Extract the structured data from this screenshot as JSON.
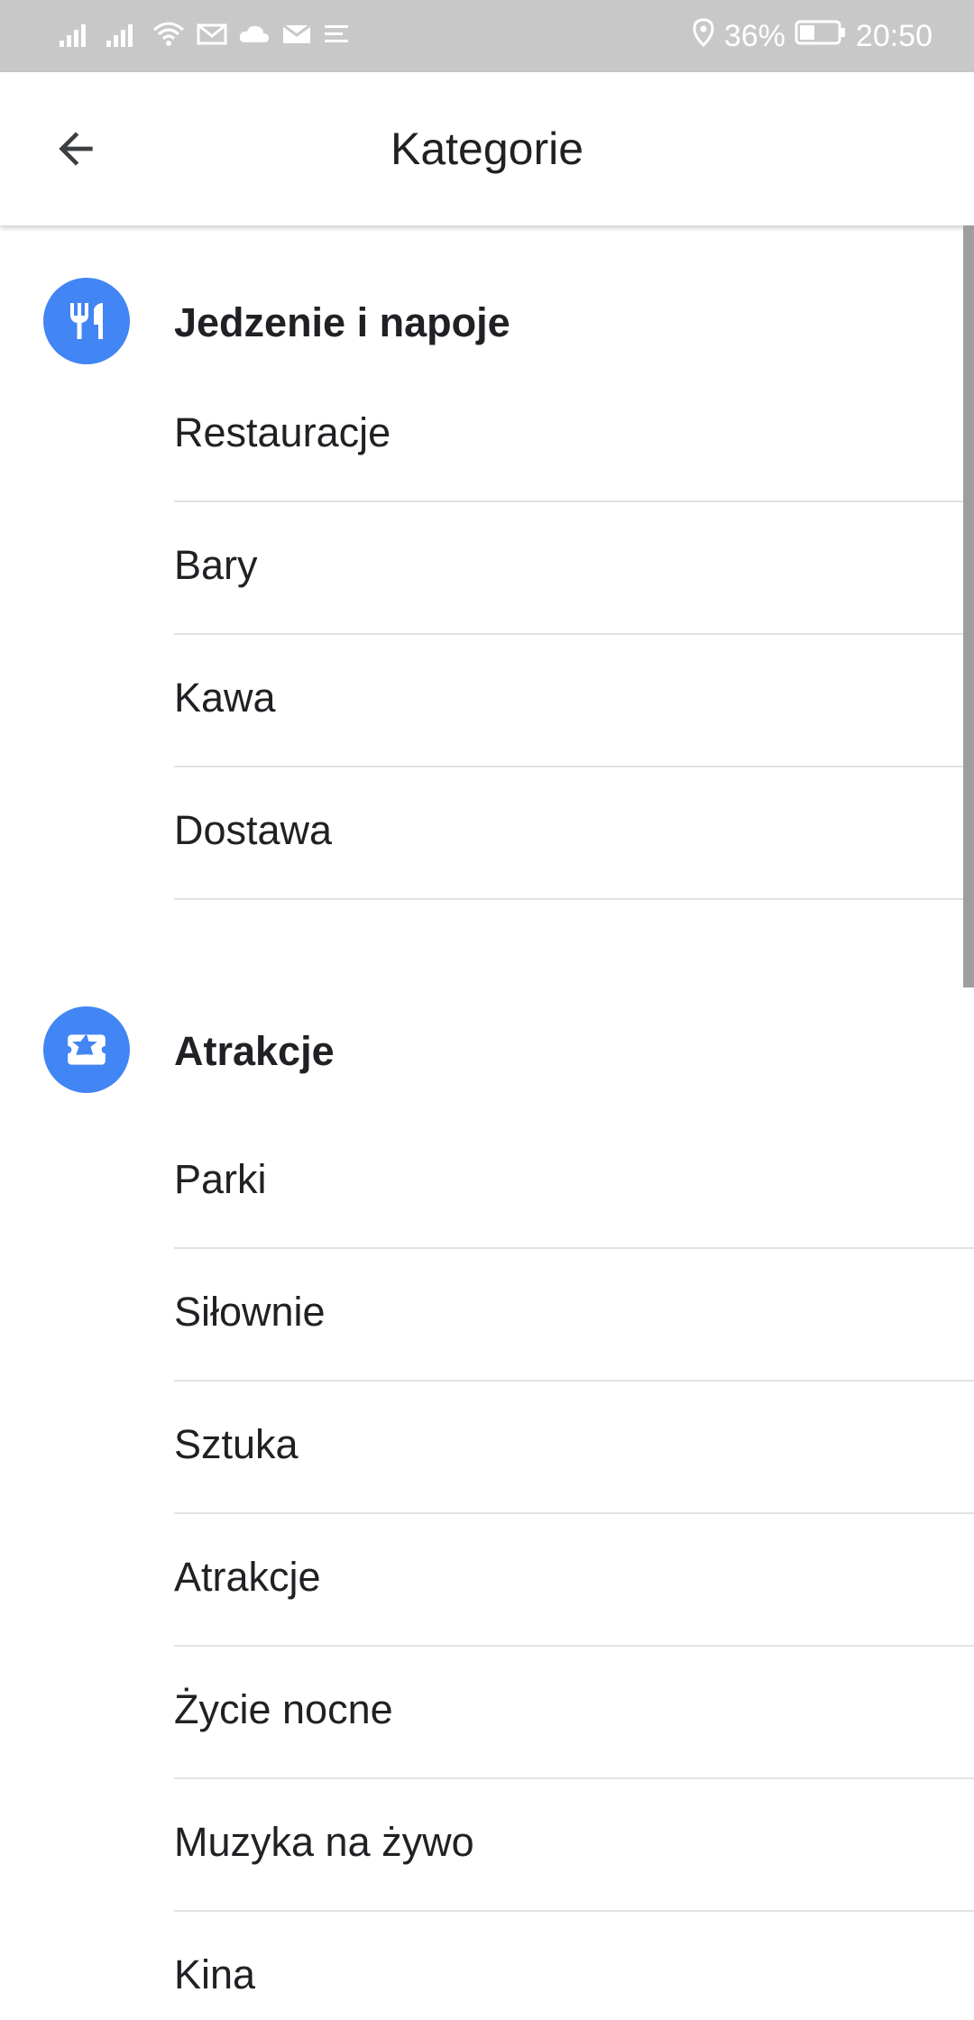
{
  "status_bar": {
    "battery_percent": "36%",
    "time": "20:50"
  },
  "header": {
    "title": "Kategorie"
  },
  "sections": [
    {
      "title": "Jedzenie i napoje",
      "icon": "fork-knife-icon",
      "items": [
        "Restauracje",
        "Bary",
        "Kawa",
        "Dostawa"
      ]
    },
    {
      "title": "Atrakcje",
      "icon": "ticket-star-icon",
      "items": [
        "Parki",
        "Siłownie",
        "Sztuka",
        "Atrakcje",
        "Życie nocne",
        "Muzyka na żywo",
        "Kina"
      ]
    }
  ],
  "colors": {
    "accent": "#4285f4",
    "status_bar": "#c8c8c8",
    "text": "#202124",
    "divider": "#e2e2e2"
  }
}
